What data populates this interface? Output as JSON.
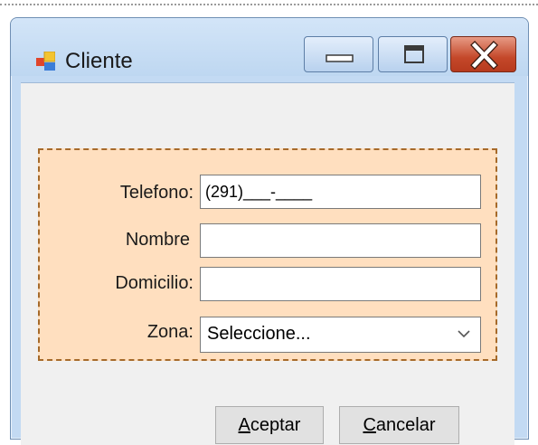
{
  "window": {
    "title": "Cliente",
    "icons": {
      "app": "form-icon",
      "minimize": "minimize-icon",
      "maximize": "maximize-icon",
      "close": "close-icon"
    }
  },
  "form": {
    "telefono": {
      "label": "Telefono:",
      "value": "(291)___-____"
    },
    "nombre": {
      "label": "Nombre",
      "value": ""
    },
    "domicilio": {
      "label": "Domicilio:",
      "value": ""
    },
    "zona": {
      "label": "Zona:",
      "selected": "Seleccione...",
      "icon": "chevron-down-icon"
    }
  },
  "buttons": {
    "accept": {
      "accel": "A",
      "rest": "ceptar"
    },
    "cancel": {
      "accel": "C",
      "rest": "ancelar"
    }
  },
  "colors": {
    "group_background": "#ffdfbf",
    "group_border": "#a66a2a",
    "window_frame": "#c3daf3",
    "close_button": "#c4482a"
  }
}
